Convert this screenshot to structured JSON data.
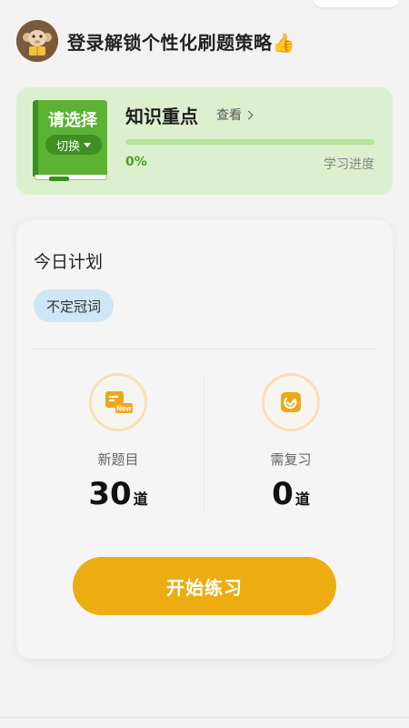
{
  "header": {
    "login_prompt": "登录解锁个性化刷题策略👍"
  },
  "knowledge": {
    "book_title": "请选择",
    "switch_label": "切换",
    "title": "知识重点",
    "view_label": "查看",
    "progress_percent_text": "0%",
    "progress_fraction": 0,
    "progress_label": "学习进度"
  },
  "plan": {
    "title": "今日计划",
    "tag": "不定冠词",
    "new_label": "新题目",
    "new_count": "30",
    "new_unit": "道",
    "new_icon_badge": "New",
    "review_label": "需复习",
    "review_count": "0",
    "review_unit": "道",
    "start_button": "开始练习"
  },
  "colors": {
    "accent": "#edac12",
    "green": "#5cb233",
    "card_green": "#dcefcf",
    "tag_blue": "#cfe6f4"
  },
  "icons": {
    "avatar": "monkey-avatar-icon",
    "new_question": "new-question-icon",
    "review": "review-check-icon"
  }
}
